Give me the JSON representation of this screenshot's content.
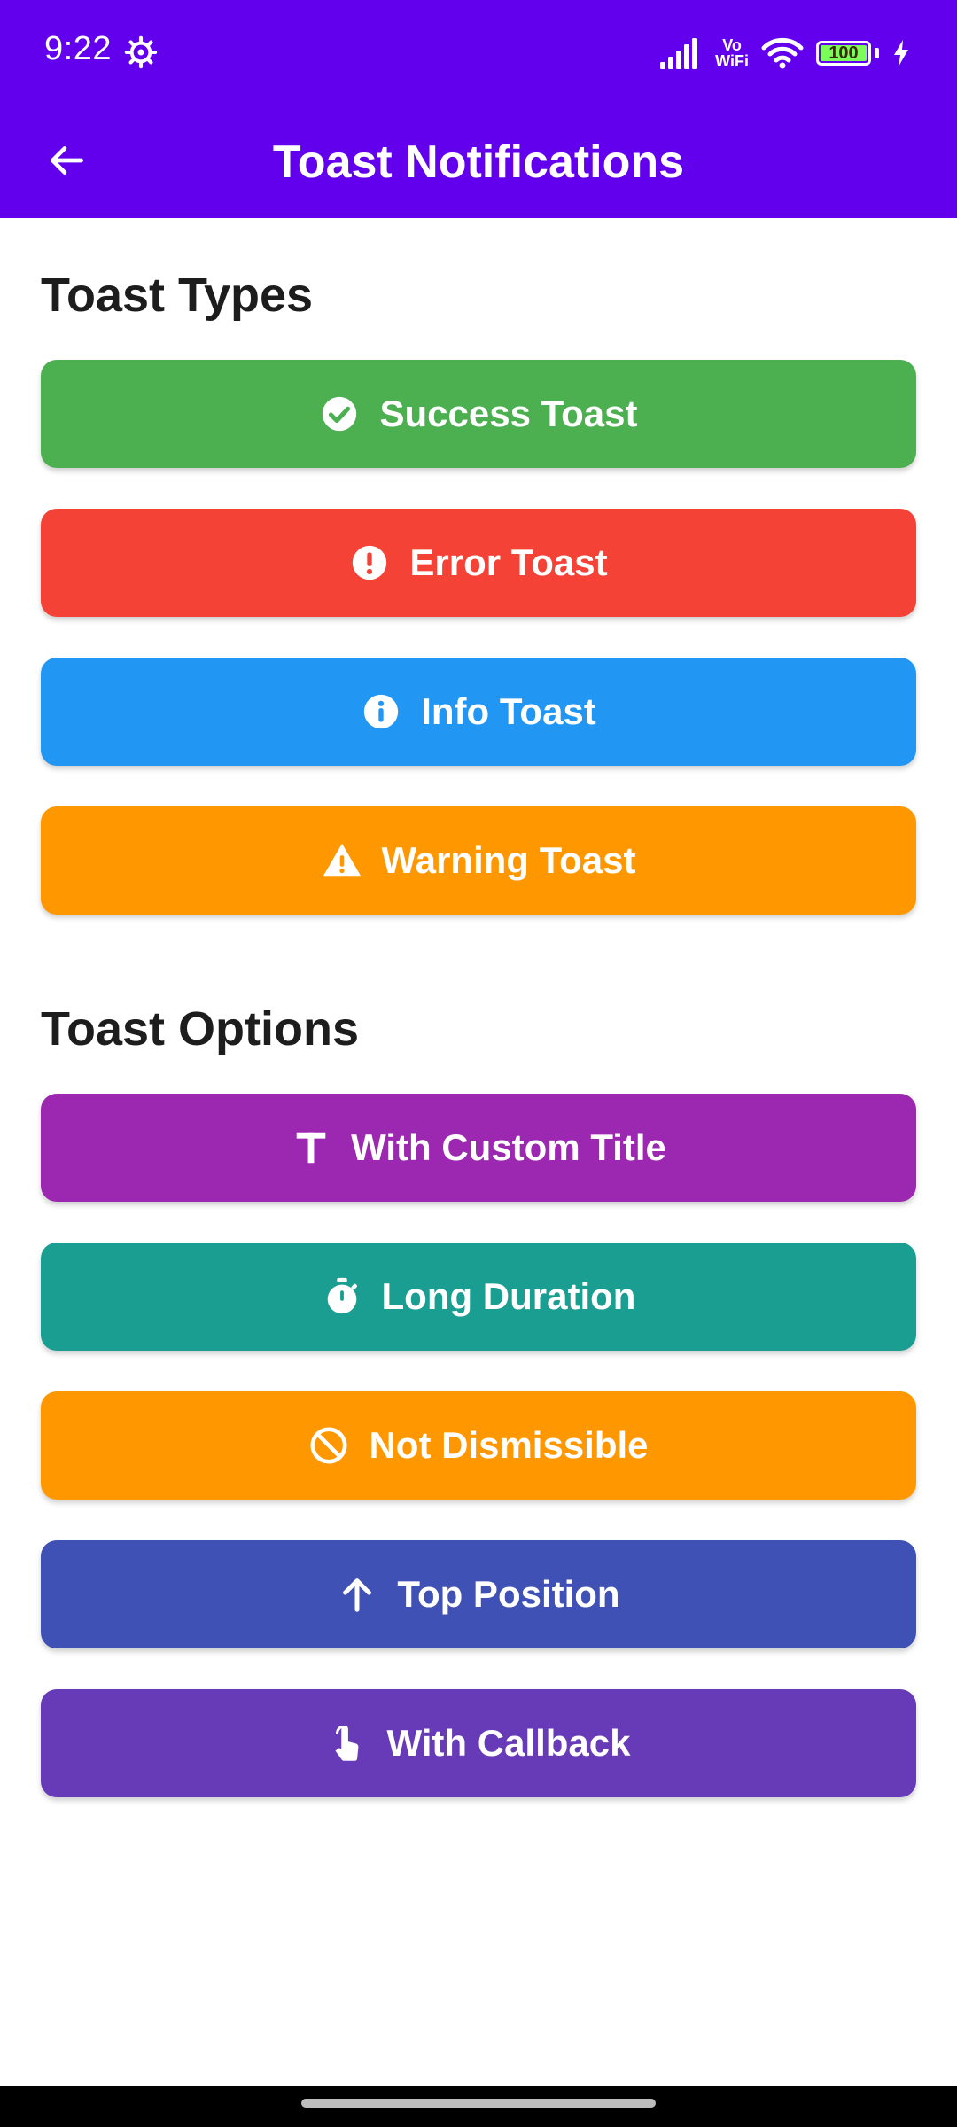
{
  "status_bar": {
    "time": "9:22",
    "vowifi_top": "Vo",
    "vowifi_bottom": "WiFi",
    "battery": "100"
  },
  "app_bar": {
    "title": "Toast Notifications"
  },
  "sections": {
    "types": {
      "title": "Toast Types",
      "buttons": [
        {
          "label": "Success Toast",
          "icon": "check-circle-icon",
          "color": "#4CAF50"
        },
        {
          "label": "Error Toast",
          "icon": "error-icon",
          "color": "#F44336"
        },
        {
          "label": "Info Toast",
          "icon": "info-icon",
          "color": "#2196F3"
        },
        {
          "label": "Warning Toast",
          "icon": "warning-icon",
          "color": "#FF9800"
        }
      ]
    },
    "options": {
      "title": "Toast Options",
      "buttons": [
        {
          "label": "With Custom Title",
          "icon": "title-icon",
          "color": "#9C27B0"
        },
        {
          "label": "Long Duration",
          "icon": "timer-icon",
          "color": "#1A9E91"
        },
        {
          "label": "Not Dismissible",
          "icon": "block-icon",
          "color": "#FF9800"
        },
        {
          "label": "Top Position",
          "icon": "arrow-up-icon",
          "color": "#3F51B5"
        },
        {
          "label": "With Callback",
          "icon": "touch-icon",
          "color": "#673AB7"
        }
      ]
    }
  },
  "colors": {
    "app_bar": "#6200EE",
    "section_title": "#1D1D1D",
    "background": "#FFFFFF"
  }
}
